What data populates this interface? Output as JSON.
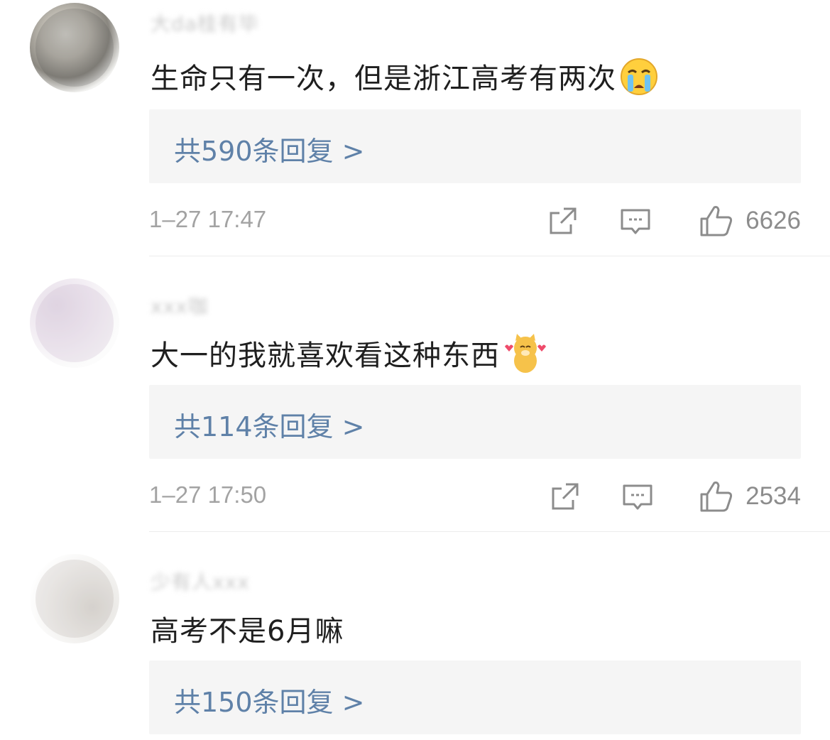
{
  "comments": [
    {
      "username": "大da桂有毕",
      "text": "生命只有一次，但是浙江高考有两次",
      "emoji": "crying-emoji",
      "replies_label": "共590条回复 >",
      "time": "1–27 17:47",
      "likes": "6626"
    },
    {
      "username": "xxx咖",
      "text": "大一的我就喜欢看这种东西",
      "emoji": "shiba-heart-sticker",
      "replies_label": "共114条回复 >",
      "time": "1–27 17:50",
      "likes": "2534"
    },
    {
      "username": "少有人xxx",
      "text": "高考不是6月嘛",
      "emoji": "",
      "replies_label": "共150条回复 >",
      "time": "",
      "likes": ""
    }
  ],
  "colors": {
    "link": "#5f81a8",
    "text": "#1f1f1f",
    "muted": "#a3a3a3",
    "reply_bg": "#f5f5f5"
  }
}
